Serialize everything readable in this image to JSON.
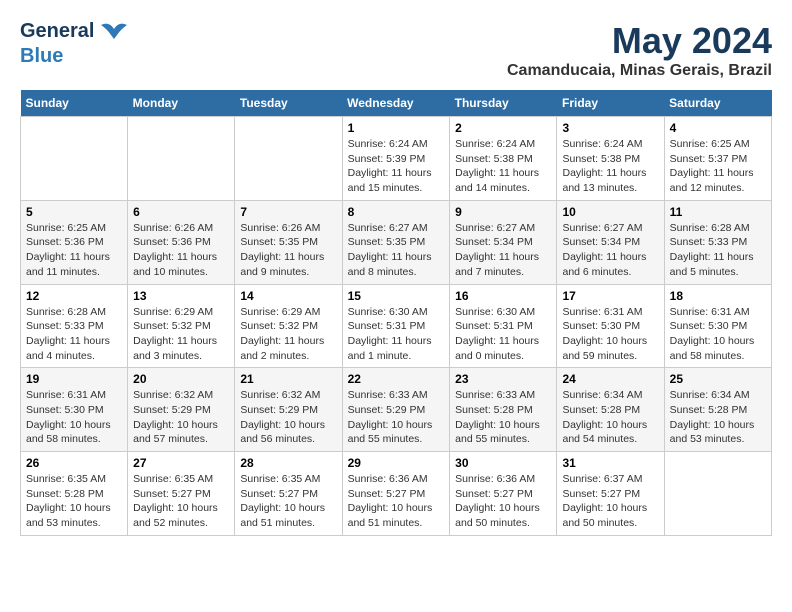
{
  "header": {
    "logo_general": "General",
    "logo_blue": "Blue",
    "month_title": "May 2024",
    "location": "Camanducaia, Minas Gerais, Brazil"
  },
  "weekdays": [
    "Sunday",
    "Monday",
    "Tuesday",
    "Wednesday",
    "Thursday",
    "Friday",
    "Saturday"
  ],
  "weeks": [
    [
      {
        "day": "",
        "info": ""
      },
      {
        "day": "",
        "info": ""
      },
      {
        "day": "",
        "info": ""
      },
      {
        "day": "1",
        "info": "Sunrise: 6:24 AM\nSunset: 5:39 PM\nDaylight: 11 hours and 15 minutes."
      },
      {
        "day": "2",
        "info": "Sunrise: 6:24 AM\nSunset: 5:38 PM\nDaylight: 11 hours and 14 minutes."
      },
      {
        "day": "3",
        "info": "Sunrise: 6:24 AM\nSunset: 5:38 PM\nDaylight: 11 hours and 13 minutes."
      },
      {
        "day": "4",
        "info": "Sunrise: 6:25 AM\nSunset: 5:37 PM\nDaylight: 11 hours and 12 minutes."
      }
    ],
    [
      {
        "day": "5",
        "info": "Sunrise: 6:25 AM\nSunset: 5:36 PM\nDaylight: 11 hours and 11 minutes."
      },
      {
        "day": "6",
        "info": "Sunrise: 6:26 AM\nSunset: 5:36 PM\nDaylight: 11 hours and 10 minutes."
      },
      {
        "day": "7",
        "info": "Sunrise: 6:26 AM\nSunset: 5:35 PM\nDaylight: 11 hours and 9 minutes."
      },
      {
        "day": "8",
        "info": "Sunrise: 6:27 AM\nSunset: 5:35 PM\nDaylight: 11 hours and 8 minutes."
      },
      {
        "day": "9",
        "info": "Sunrise: 6:27 AM\nSunset: 5:34 PM\nDaylight: 11 hours and 7 minutes."
      },
      {
        "day": "10",
        "info": "Sunrise: 6:27 AM\nSunset: 5:34 PM\nDaylight: 11 hours and 6 minutes."
      },
      {
        "day": "11",
        "info": "Sunrise: 6:28 AM\nSunset: 5:33 PM\nDaylight: 11 hours and 5 minutes."
      }
    ],
    [
      {
        "day": "12",
        "info": "Sunrise: 6:28 AM\nSunset: 5:33 PM\nDaylight: 11 hours and 4 minutes."
      },
      {
        "day": "13",
        "info": "Sunrise: 6:29 AM\nSunset: 5:32 PM\nDaylight: 11 hours and 3 minutes."
      },
      {
        "day": "14",
        "info": "Sunrise: 6:29 AM\nSunset: 5:32 PM\nDaylight: 11 hours and 2 minutes."
      },
      {
        "day": "15",
        "info": "Sunrise: 6:30 AM\nSunset: 5:31 PM\nDaylight: 11 hours and 1 minute."
      },
      {
        "day": "16",
        "info": "Sunrise: 6:30 AM\nSunset: 5:31 PM\nDaylight: 11 hours and 0 minutes."
      },
      {
        "day": "17",
        "info": "Sunrise: 6:31 AM\nSunset: 5:30 PM\nDaylight: 10 hours and 59 minutes."
      },
      {
        "day": "18",
        "info": "Sunrise: 6:31 AM\nSunset: 5:30 PM\nDaylight: 10 hours and 58 minutes."
      }
    ],
    [
      {
        "day": "19",
        "info": "Sunrise: 6:31 AM\nSunset: 5:30 PM\nDaylight: 10 hours and 58 minutes."
      },
      {
        "day": "20",
        "info": "Sunrise: 6:32 AM\nSunset: 5:29 PM\nDaylight: 10 hours and 57 minutes."
      },
      {
        "day": "21",
        "info": "Sunrise: 6:32 AM\nSunset: 5:29 PM\nDaylight: 10 hours and 56 minutes."
      },
      {
        "day": "22",
        "info": "Sunrise: 6:33 AM\nSunset: 5:29 PM\nDaylight: 10 hours and 55 minutes."
      },
      {
        "day": "23",
        "info": "Sunrise: 6:33 AM\nSunset: 5:28 PM\nDaylight: 10 hours and 55 minutes."
      },
      {
        "day": "24",
        "info": "Sunrise: 6:34 AM\nSunset: 5:28 PM\nDaylight: 10 hours and 54 minutes."
      },
      {
        "day": "25",
        "info": "Sunrise: 6:34 AM\nSunset: 5:28 PM\nDaylight: 10 hours and 53 minutes."
      }
    ],
    [
      {
        "day": "26",
        "info": "Sunrise: 6:35 AM\nSunset: 5:28 PM\nDaylight: 10 hours and 53 minutes."
      },
      {
        "day": "27",
        "info": "Sunrise: 6:35 AM\nSunset: 5:27 PM\nDaylight: 10 hours and 52 minutes."
      },
      {
        "day": "28",
        "info": "Sunrise: 6:35 AM\nSunset: 5:27 PM\nDaylight: 10 hours and 51 minutes."
      },
      {
        "day": "29",
        "info": "Sunrise: 6:36 AM\nSunset: 5:27 PM\nDaylight: 10 hours and 51 minutes."
      },
      {
        "day": "30",
        "info": "Sunrise: 6:36 AM\nSunset: 5:27 PM\nDaylight: 10 hours and 50 minutes."
      },
      {
        "day": "31",
        "info": "Sunrise: 6:37 AM\nSunset: 5:27 PM\nDaylight: 10 hours and 50 minutes."
      },
      {
        "day": "",
        "info": ""
      }
    ]
  ]
}
